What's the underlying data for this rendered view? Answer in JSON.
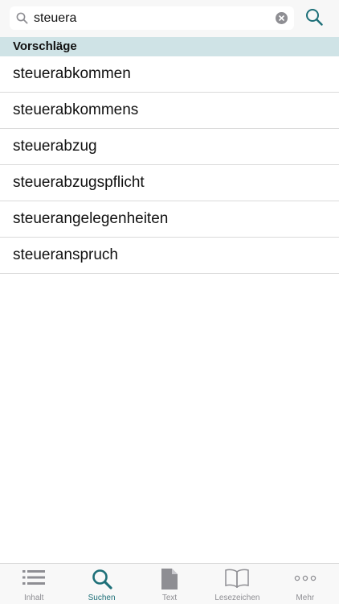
{
  "search": {
    "query": "steuera",
    "icon": "search-icon",
    "clear_icon": "clear-circle-icon",
    "action_icon": "search-icon"
  },
  "section": {
    "title": "Vorschläge"
  },
  "suggestions": [
    "steuerabkommen",
    "steuerabkommens",
    "steuerabzug",
    "steuerabzugspflicht",
    "steuerangelegenheiten",
    "steueranspruch"
  ],
  "tabs": [
    {
      "label": "Inhalt",
      "icon": "list-icon",
      "active": false
    },
    {
      "label": "Suchen",
      "icon": "search-icon",
      "active": true
    },
    {
      "label": "Text",
      "icon": "document-icon",
      "active": false
    },
    {
      "label": "Lesezeichen",
      "icon": "book-icon",
      "active": false
    },
    {
      "label": "Mehr",
      "icon": "more-dots-icon",
      "active": false
    }
  ],
  "colors": {
    "accent": "#1d6f78",
    "section_bg": "#cfe3e6",
    "inactive": "#8e8e93"
  }
}
